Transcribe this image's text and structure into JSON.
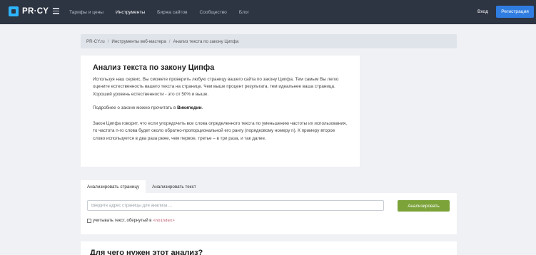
{
  "header": {
    "logo_text": "PR·CY",
    "nav": [
      {
        "label": "Тарифы и цены",
        "active": false
      },
      {
        "label": "Инструменты",
        "active": true
      },
      {
        "label": "Биржа сайтов",
        "active": false
      },
      {
        "label": "Сообщество",
        "active": false
      },
      {
        "label": "Блог",
        "active": false
      }
    ],
    "login_label": "Вход",
    "register_label": "Регистрация"
  },
  "breadcrumb": [
    "PR-CY.ru",
    "Инструменты веб-мастера",
    "Анализ текста по закону Ципфа"
  ],
  "intro": {
    "title": "Анализ текста по закону Ципфа",
    "para1": "Используя наш сервис, Вы сможете проверить любую страницу вашего сайта по закону Ципфа. Тем самым Вы легко оцените естественность вашего текста на странице. Чем выше процент результата, тем идеальнее ваша страница. Хороший уровень естественности - это от 50% и выше.",
    "para2_text": "Подробнее о законе можно прочитать в ",
    "para2_link": "Википедии",
    "para2_end": ".",
    "para3": "Закон Ципфа говорит, что если упорядочить все слова определенного текста по уменьшению частоты их использования, то частота n-го слова будет около обратно-пропорциональной его рангу (порядковому номеру n). К примеру второе слово используется в два раза реже, чем первое, третье – в три раза, и так далее."
  },
  "tabs": [
    {
      "label": "Анализировать страницу",
      "active": true
    },
    {
      "label": "Анализировать текст",
      "active": false
    }
  ],
  "form": {
    "url_placeholder": "Введите адрес страницы для анализа ...",
    "url_value": "",
    "analyze_label": "Анализировать",
    "checkbox_label": "учитывать текст, обернутый в",
    "checkbox_code": "<noindex>",
    "checkbox_checked": false
  },
  "next_section": {
    "title": "Для чего нужен этот анализ?"
  },
  "colors": {
    "topbar": "#2d3442",
    "register": "#2f7de1",
    "analyze": "#7ba33a",
    "page_bg": "#f0f1f4"
  }
}
